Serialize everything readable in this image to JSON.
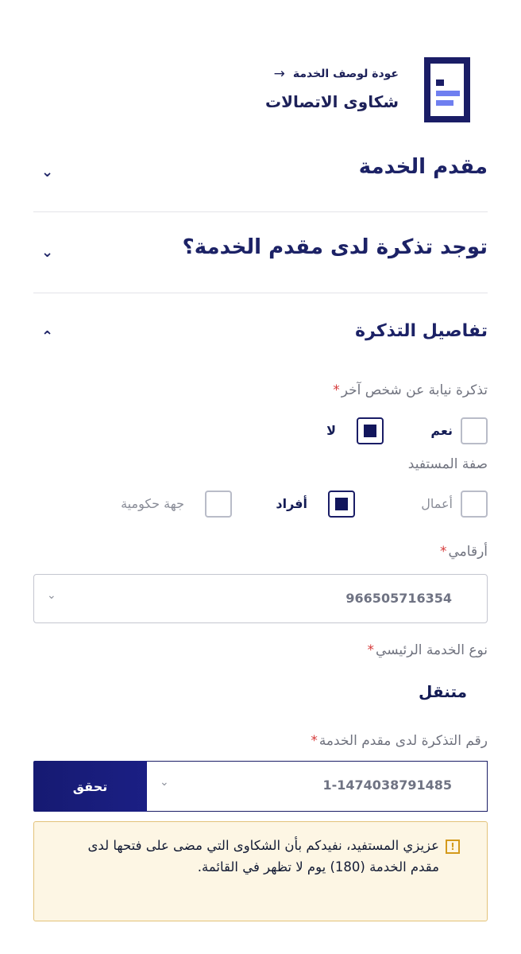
{
  "header": {
    "back_label": "عودة لوصف الخدمة",
    "service_title": "شكاوى الاتصالات"
  },
  "sections": {
    "provider": {
      "title": "مقدم الخدمة",
      "expanded": false
    },
    "has_ticket": {
      "title": "توجد تذكرة لدى مقدم الخدمة؟",
      "expanded": false
    },
    "ticket_details": {
      "title": "تفاصيل التذكرة",
      "expanded": true
    }
  },
  "form": {
    "on_behalf": {
      "label": "تذكرة نيابة عن شخص آخر",
      "required_mark": "*",
      "options": [
        {
          "label": "نعم",
          "checked": false
        },
        {
          "label": "لا",
          "checked": true
        }
      ]
    },
    "beneficiary_type": {
      "label": "صفة المستفيد",
      "options": [
        {
          "label": "أعمال",
          "checked": false
        },
        {
          "label": "أفراد",
          "checked": true
        },
        {
          "label": "جهة حكومية",
          "checked": false
        }
      ]
    },
    "my_numbers": {
      "label": "أرقامي",
      "required_mark": "*",
      "value": "966505716354"
    },
    "main_service_type": {
      "label": "نوع الخدمة الرئيسي",
      "required_mark": "*",
      "value": "متنقل"
    },
    "ticket_number": {
      "label": "رقم التذكرة لدى مقدم الخدمة",
      "required_mark": "*",
      "value": "1-1474038791485",
      "verify_label": "تحقق"
    },
    "notice": {
      "icon": "info-icon",
      "text": "عزيزي المستفيد، نفيدكم بأن الشكاوى التي مضى على فتحها لدى مقدم الخدمة (180) يوم لا تظهر في القائمة."
    }
  },
  "colors": {
    "primary": "#1a1d66",
    "accent_bar": "#6f7ff0",
    "notice_bg": "#fdf6e4",
    "notice_border": "#e3c27a",
    "required": "#d63a3a"
  }
}
